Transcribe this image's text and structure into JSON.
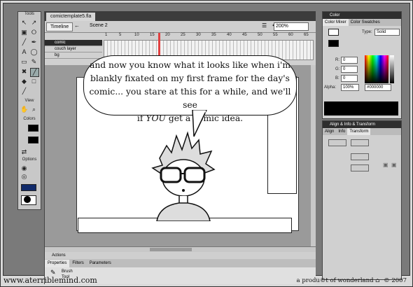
{
  "tools": {
    "title": "Tools",
    "view_label": "View",
    "colors_label": "Colors",
    "options_label": "Options"
  },
  "document": {
    "tab_title": "comictemplate5.fla",
    "timeline_button": "Timeline",
    "scene_label": "Scene 2",
    "zoom": "200%",
    "frame_numbers": [
      "1",
      "5",
      "10",
      "15",
      "20",
      "25",
      "30",
      "35",
      "40",
      "45",
      "50",
      "55",
      "60",
      "65"
    ],
    "layers": [
      "comic",
      "couch layer",
      "bg"
    ]
  },
  "panels": {
    "actions_label": "Actions",
    "properties_tabs": [
      "Properties",
      "Filters",
      "Parameters"
    ],
    "properties_tool": "Brush",
    "properties_tool_sub": "Tool"
  },
  "color_panel": {
    "title": "Color",
    "tabs": [
      "Color Mixer",
      "Color Swatches"
    ],
    "type_label": "Type:",
    "type_value": "Solid",
    "r_label": "R:",
    "r_value": "0",
    "g_label": "G:",
    "g_value": "0",
    "b_label": "B:",
    "b_value": "0",
    "alpha_label": "Alpha:",
    "alpha_value": "100%",
    "hex_value": "#000000"
  },
  "align_panel": {
    "title": "Align & Info & Transform",
    "tabs": [
      "Align",
      "Info",
      "Transform"
    ]
  },
  "bubble": {
    "line1": "and now you know what it looks like when i'm",
    "line2": "blankly fixated on my first frame for the day's",
    "line3": "comic... you stare at this for a while, and we'll see",
    "line4_pre": "if",
    "line4_em": "YOU",
    "line4_post": "get a comic idea."
  },
  "footer": {
    "site": "www.aterriblemind.com",
    "credit": "a produ©t of wonderland",
    "copyright": "© 2007"
  }
}
